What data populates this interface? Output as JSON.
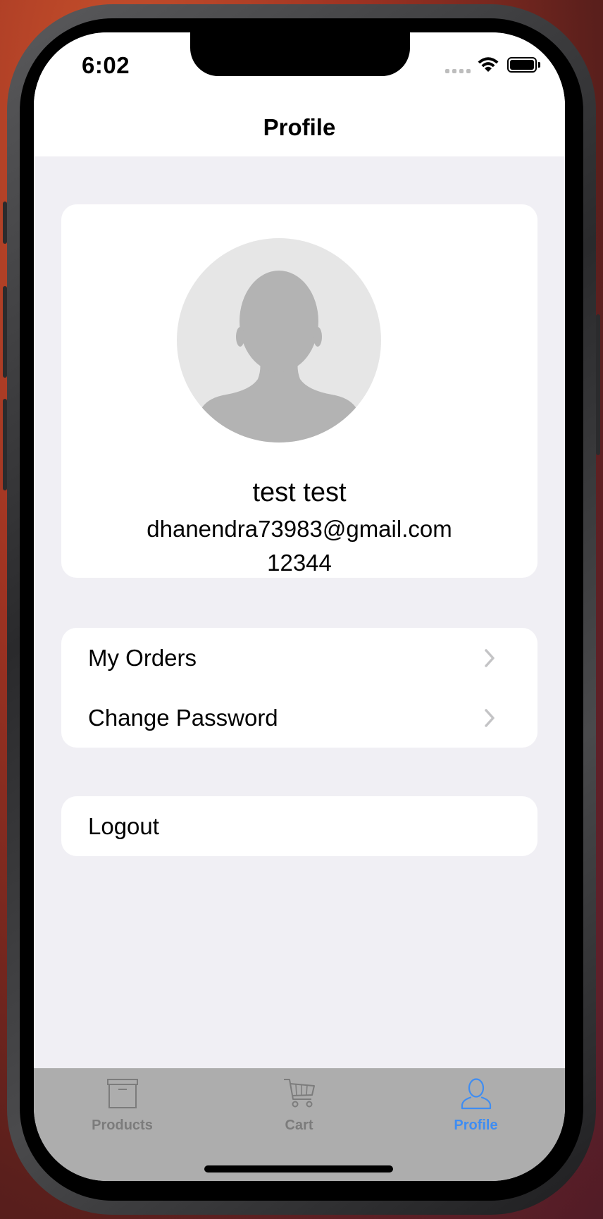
{
  "status_bar": {
    "time": "6:02"
  },
  "nav": {
    "title": "Profile"
  },
  "profile": {
    "name": "test test",
    "email": "dhanendra73983@gmail.com",
    "phone": "12344"
  },
  "menu": {
    "items": [
      {
        "label": "My Orders"
      },
      {
        "label": "Change Password"
      }
    ],
    "logout_label": "Logout"
  },
  "tab_bar": {
    "tabs": [
      {
        "label": "Products",
        "icon": "archive-box-icon",
        "active": false
      },
      {
        "label": "Cart",
        "icon": "cart-icon",
        "active": false
      },
      {
        "label": "Profile",
        "icon": "person-icon",
        "active": true
      }
    ],
    "active_color": "#3f8df2",
    "inactive_color": "#7c7c7c"
  }
}
